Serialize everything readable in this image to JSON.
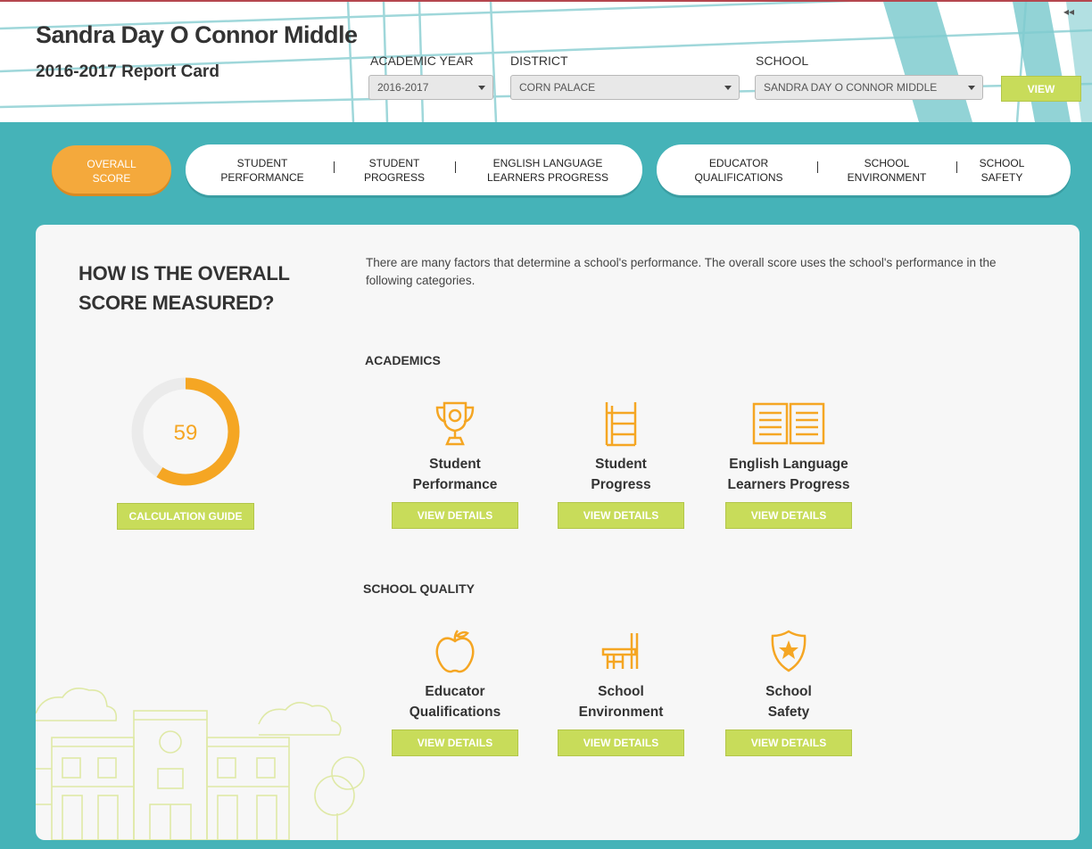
{
  "header": {
    "school_name": "Sandra Day O Connor Middle",
    "report_title": "2016-2017 Report Card",
    "collapse_glyph": "◂◂",
    "filters": {
      "academic_year": {
        "label": "ACADEMIC YEAR",
        "value": "2016-2017"
      },
      "district": {
        "label": "DISTRICT",
        "value": "CORN PALACE"
      },
      "school": {
        "label": "SCHOOL",
        "value": "SANDRA DAY O CONNOR MIDDLE"
      }
    },
    "view_label": "VIEW"
  },
  "tabs": {
    "overall": [
      "OVERALL",
      "SCORE"
    ],
    "student_performance": [
      "STUDENT",
      "PERFORMANCE"
    ],
    "student_progress": [
      "STUDENT",
      "PROGRESS"
    ],
    "ell_progress": [
      "ENGLISH LANGUAGE",
      "LEARNERS PROGRESS"
    ],
    "educator_qualifications": [
      "EDUCATOR",
      "QUALIFICATIONS"
    ],
    "school_environment": [
      "SCHOOL",
      "ENVIRONMENT"
    ],
    "school_safety": [
      "SCHOOL",
      "SAFETY"
    ]
  },
  "main": {
    "how_title": "HOW IS THE OVERALL SCORE MEASURED?",
    "intro": "There are many factors that determine a school's performance. The overall score uses the school's performance in the following categories.",
    "overall_score": 59,
    "overall_score_max": 100,
    "calculation_guide_label": "CALCULATION GUIDE",
    "accent_color": "#f5a623",
    "button_color": "#c8dc5a",
    "academics": {
      "title": "ACADEMICS",
      "items": [
        {
          "icon": "trophy-icon",
          "label": [
            "Student",
            "Performance"
          ],
          "button": "VIEW DETAILS"
        },
        {
          "icon": "ladder-icon",
          "label": [
            "Student",
            "Progress"
          ],
          "button": "VIEW DETAILS"
        },
        {
          "icon": "open-book-icon",
          "label": [
            "English Language",
            "Learners Progress"
          ],
          "button": "VIEW DETAILS"
        }
      ]
    },
    "school_quality": {
      "title": "SCHOOL QUALITY",
      "items": [
        {
          "icon": "apple-icon",
          "label": [
            "Educator",
            "Qualifications"
          ],
          "button": "VIEW DETAILS"
        },
        {
          "icon": "desk-icon",
          "label": [
            "School",
            "Environment"
          ],
          "button": "VIEW DETAILS"
        },
        {
          "icon": "shield-star-icon",
          "label": [
            "School",
            "Safety"
          ],
          "button": "VIEW DETAILS"
        }
      ]
    }
  }
}
